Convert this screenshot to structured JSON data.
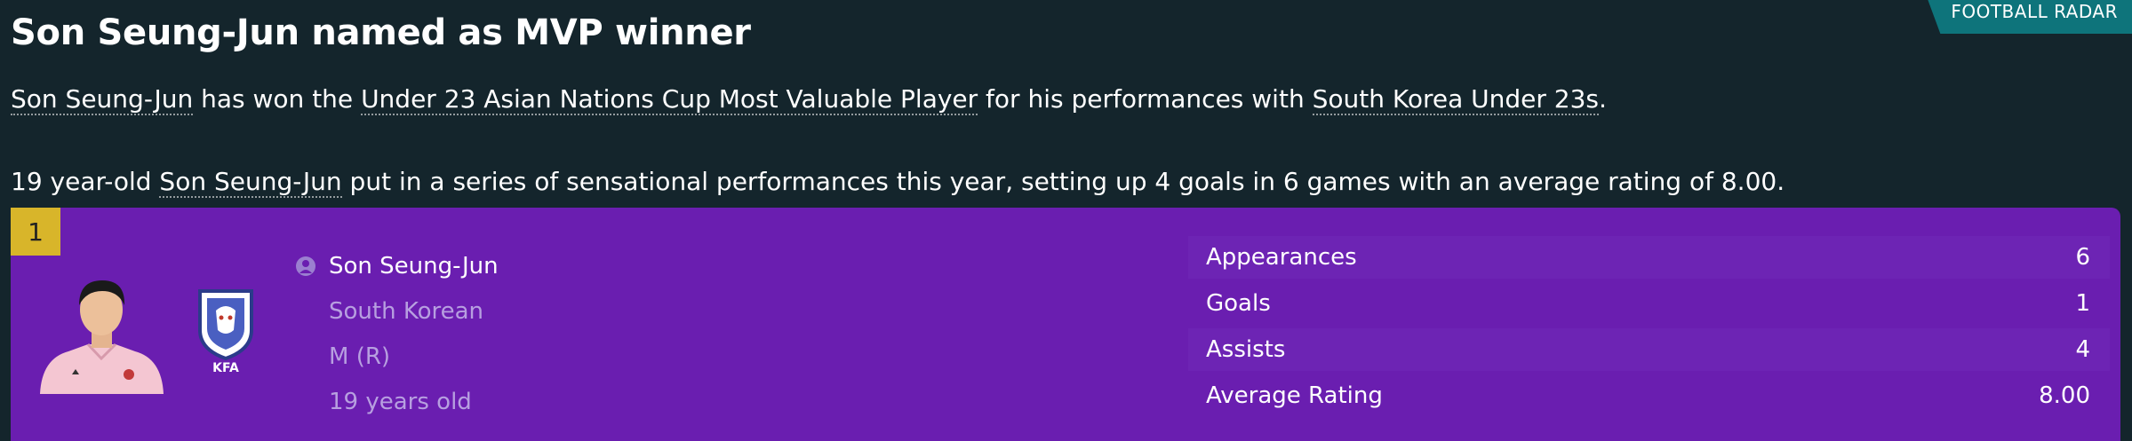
{
  "badge": "FOOTBALL RADAR",
  "headline": "Son Seung-Jun named as MVP winner",
  "para1": {
    "player": "Son Seung-Jun",
    "t1": " has won the ",
    "award": "Under 23 Asian Nations Cup Most Valuable Player",
    "t2": " for his performances with ",
    "team": "South Korea Under 23s",
    "t3": "."
  },
  "para2": {
    "t1": "19 year-old ",
    "player": "Son Seung-Jun",
    "t2": " put in a series of sensational performances this year, setting up 4 goals in 6 games with an average rating of 8.00."
  },
  "card": {
    "rank": "1",
    "crest_text": "KFA",
    "name": "Son Seung-Jun",
    "nationality": "South Korean",
    "position": "M (R)",
    "age": "19 years old",
    "stats": [
      {
        "label": "Appearances",
        "value": "6"
      },
      {
        "label": "Goals",
        "value": "1"
      },
      {
        "label": "Assists",
        "value": "4"
      },
      {
        "label": "Average Rating",
        "value": "8.00"
      }
    ]
  },
  "colors": {
    "background": "#14252c",
    "badge": "#0e747b",
    "card": "#6a1eb0",
    "rank": "#d8b52a",
    "muted_text": "#b79fe0"
  }
}
